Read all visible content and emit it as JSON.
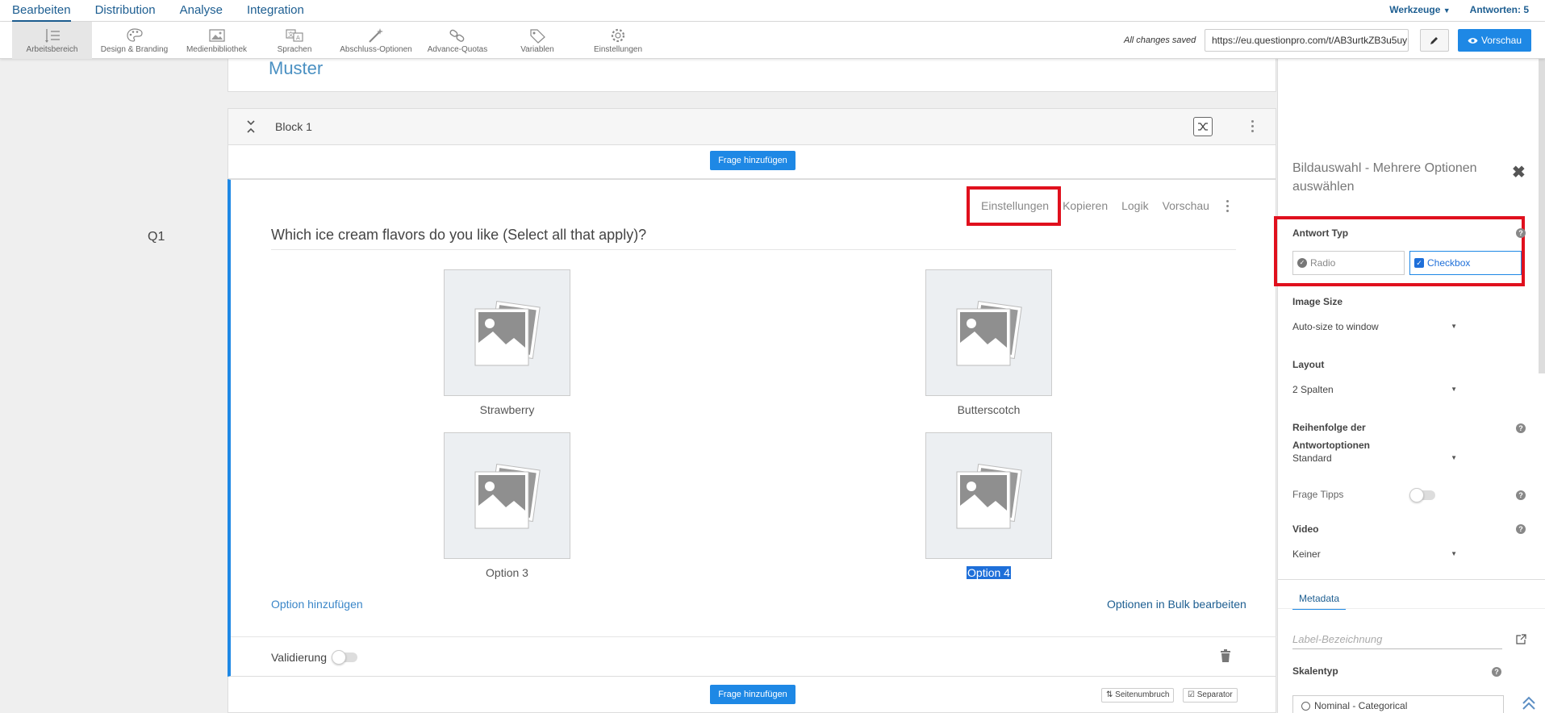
{
  "topnav": {
    "menu": [
      "Bearbeiten",
      "Distribution",
      "Analyse",
      "Integration"
    ],
    "werkzeuge": "Werkzeuge",
    "antworten": "Antworten: 5"
  },
  "toolbar": {
    "tools": [
      "Arbeitsbereich",
      "Design & Branding",
      "Medienbibliothek",
      "Sprachen",
      "Abschluss-Optionen",
      "Advance-Quotas",
      "Variablen",
      "Einstellungen"
    ],
    "saved": "All changes saved",
    "url": "https://eu.questionpro.com/t/AB3urtkZB3u5uy",
    "preview": "Vorschau"
  },
  "survey": {
    "title": "Muster",
    "block_title": "Block 1",
    "add_question": "Frage hinzufügen",
    "question_number": "Q1",
    "question_text": "Which ice cream flavors do you like (Select all that apply)?",
    "actions": [
      "Einstellungen",
      "Kopieren",
      "Logik",
      "Vorschau"
    ],
    "options": [
      "Strawberry",
      "Butterscotch",
      "Option 3",
      "Option 4"
    ],
    "add_option": "Option hinzufügen",
    "bulk_edit": "Optionen in Bulk bearbeiten",
    "validation": "Validierung",
    "page_break": "Seitenumbruch",
    "separator": "Separator"
  },
  "panel": {
    "title": "Bildauswahl - Mehrere Optionen auswählen",
    "answer_type_label": "Antwort Typ",
    "radio": "Radio",
    "checkbox": "Checkbox",
    "image_size_label": "Image Size",
    "image_size_value": "Auto-size to window",
    "layout_label": "Layout",
    "layout_value": "2 Spalten",
    "order_label_1": "Reihenfolge der",
    "order_label_2": "Antwortoptionen",
    "order_value": "Standard",
    "tips_label": "Frage Tipps",
    "video_label": "Video",
    "video_value": "Keiner",
    "metadata_tab": "Metadata",
    "label_placeholder": "Label-Bezeichnung",
    "scale_label": "Skalentyp",
    "scale_value": "Nominal - Categorical"
  },
  "colors": {
    "accent": "#1e88e5",
    "highlight": "#e0101d",
    "link": "#1d5e91"
  }
}
